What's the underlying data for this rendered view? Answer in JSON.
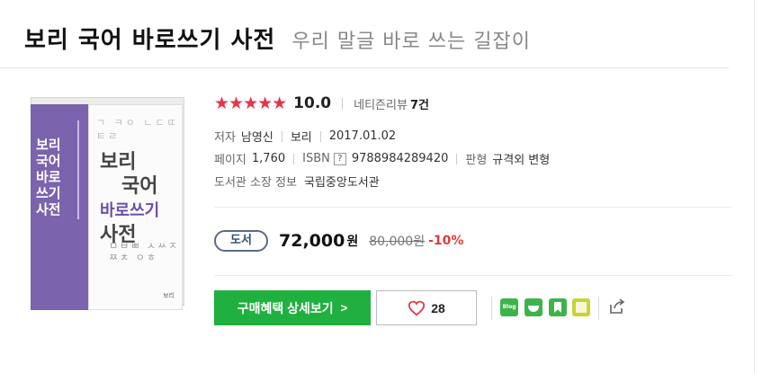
{
  "header": {
    "title": "보리 국어 바로쓰기 사전",
    "subtitle": "우리 말글 바로 쓰는 길잡이"
  },
  "cover": {
    "spine_title": "보리 국어 바로쓰기 사전",
    "front_top": "ㄱ ㅋㅇ ㄴㄷㄸㅌㄹ",
    "front_title_1": "보리",
    "front_title_2": "국어",
    "front_title_3": "바로쓰기",
    "front_title_4": "사전",
    "front_bottom": "ㅁㅂㅃ ㅅㅆㅈㅉㅊ ㅇㅎ",
    "publisher_mark": "보리"
  },
  "rating": {
    "stars": "★★★★★",
    "score": "10.0",
    "review_label": "네티즌리뷰",
    "review_count": "7건"
  },
  "info": {
    "author_label": "저자",
    "author": "남영신",
    "publisher": "보리",
    "date": "2017.01.02",
    "pages_label": "페이지",
    "pages": "1,760",
    "isbn_label": "ISBN",
    "isbn_help": "?",
    "isbn": "9788984289420",
    "format_label": "판형",
    "format": "규격외 변형",
    "library_label": "도서관 소장 정보",
    "library": "국립중앙도서관"
  },
  "price": {
    "badge": "도서",
    "sale": "72,000",
    "won": "원",
    "original": "80,000원",
    "discount": "-10%"
  },
  "actions": {
    "buy_label": "구매혜택 상세보기",
    "buy_chevron": ">",
    "like_count": "28",
    "blog_label": "Blog"
  },
  "colors": {
    "accent_green": "#1fb040",
    "star_red": "#e8334a",
    "discount_red": "#e03a3a",
    "cover_purple": "#7b63ad",
    "badge_blue": "#2f4c77"
  },
  "icons": [
    "heart-icon",
    "blog-icon",
    "cafe-icon",
    "bookmark-icon",
    "memo-icon",
    "share-icon"
  ]
}
